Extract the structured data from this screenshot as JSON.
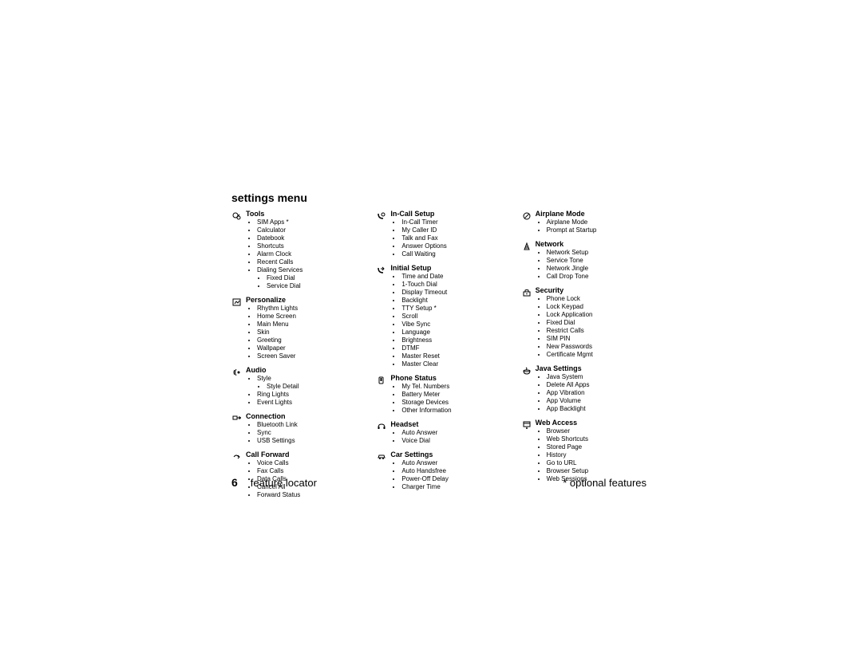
{
  "page_title": "settings menu",
  "page_number": "6",
  "page_footer": "feature locator",
  "optional_note": "* optional features",
  "columns": [
    {
      "sections": [
        {
          "icon": "tools",
          "title": "Tools",
          "items": [
            {
              "label": "SIM Apps *"
            },
            {
              "label": "Calculator"
            },
            {
              "label": "Datebook"
            },
            {
              "label": "Shortcuts"
            },
            {
              "label": "Alarm Clock"
            },
            {
              "label": "Recent Calls"
            },
            {
              "label": "Dialing Services",
              "sub": [
                "Fixed Dial",
                "Service Dial"
              ]
            }
          ]
        },
        {
          "icon": "personalize",
          "title": "Personalize",
          "items": [
            {
              "label": "Rhythm Lights"
            },
            {
              "label": "Home Screen"
            },
            {
              "label": "Main Menu"
            },
            {
              "label": "Skin"
            },
            {
              "label": "Greeting"
            },
            {
              "label": "Wallpaper"
            },
            {
              "label": "Screen Saver"
            }
          ]
        },
        {
          "icon": "audio",
          "title": "Audio",
          "items": [
            {
              "label": "Style",
              "sub": [
                "Style Detail"
              ]
            },
            {
              "label": "Ring Lights"
            },
            {
              "label": "Event Lights"
            }
          ]
        },
        {
          "icon": "connection",
          "title": "Connection",
          "items": [
            {
              "label": "Bluetooth Link"
            },
            {
              "label": "Sync"
            },
            {
              "label": "USB Settings"
            }
          ]
        },
        {
          "icon": "callforward",
          "title": "Call Forward",
          "items": [
            {
              "label": "Voice Calls"
            },
            {
              "label": "Fax Calls"
            },
            {
              "label": "Data Calls"
            },
            {
              "label": "Cancel All"
            },
            {
              "label": "Forward Status"
            }
          ]
        }
      ]
    },
    {
      "sections": [
        {
          "icon": "incall",
          "title": "In-Call Setup",
          "items": [
            {
              "label": "In-Call Timer"
            },
            {
              "label": "My Caller ID"
            },
            {
              "label": "Talk and Fax"
            },
            {
              "label": "Answer Options"
            },
            {
              "label": "Call Waiting"
            }
          ]
        },
        {
          "icon": "initial",
          "title": "Initial Setup",
          "items": [
            {
              "label": "Time and Date"
            },
            {
              "label": "1-Touch Dial"
            },
            {
              "label": "Display Timeout"
            },
            {
              "label": "Backlight"
            },
            {
              "label": "TTY Setup *"
            },
            {
              "label": "Scroll"
            },
            {
              "label": "Vibe Sync"
            },
            {
              "label": "Language"
            },
            {
              "label": "Brightness"
            },
            {
              "label": "DTMF"
            },
            {
              "label": "Master Reset"
            },
            {
              "label": "Master Clear"
            }
          ]
        },
        {
          "icon": "phonestatus",
          "title": "Phone Status",
          "items": [
            {
              "label": "My Tel. Numbers"
            },
            {
              "label": "Battery Meter"
            },
            {
              "label": "Storage Devices"
            },
            {
              "label": "Other Information"
            }
          ]
        },
        {
          "icon": "headset",
          "title": "Headset",
          "items": [
            {
              "label": "Auto Answer"
            },
            {
              "label": "Voice Dial"
            }
          ]
        },
        {
          "icon": "car",
          "title": "Car Settings",
          "items": [
            {
              "label": "Auto Answer"
            },
            {
              "label": "Auto Handsfree"
            },
            {
              "label": "Power-Off Delay"
            },
            {
              "label": "Charger Time"
            }
          ]
        }
      ]
    },
    {
      "sections": [
        {
          "icon": "airplane",
          "title": "Airplane Mode",
          "items": [
            {
              "label": "Airplane Mode"
            },
            {
              "label": "Prompt at Startup"
            }
          ]
        },
        {
          "icon": "network",
          "title": "Network",
          "items": [
            {
              "label": "Network Setup"
            },
            {
              "label": "Service Tone"
            },
            {
              "label": "Network Jingle"
            },
            {
              "label": "Call Drop Tone"
            }
          ]
        },
        {
          "icon": "security",
          "title": "Security",
          "items": [
            {
              "label": "Phone Lock"
            },
            {
              "label": "Lock Keypad"
            },
            {
              "label": "Lock Application"
            },
            {
              "label": "Fixed Dial"
            },
            {
              "label": "Restrict Calls"
            },
            {
              "label": "SIM PIN"
            },
            {
              "label": "New Passwords"
            },
            {
              "label": "Certificate Mgmt"
            }
          ]
        },
        {
          "icon": "java",
          "title": "Java Settings",
          "items": [
            {
              "label": "Java System"
            },
            {
              "label": "Delete All Apps"
            },
            {
              "label": "App Vibration"
            },
            {
              "label": "App Volume"
            },
            {
              "label": "App Backlight"
            }
          ]
        },
        {
          "icon": "web",
          "title": "Web Access",
          "items": [
            {
              "label": "Browser"
            },
            {
              "label": "Web Shortcuts"
            },
            {
              "label": "Stored Page"
            },
            {
              "label": "History"
            },
            {
              "label": "Go to URL"
            },
            {
              "label": "Browser Setup"
            },
            {
              "label": "Web Sessions"
            }
          ]
        }
      ]
    }
  ]
}
